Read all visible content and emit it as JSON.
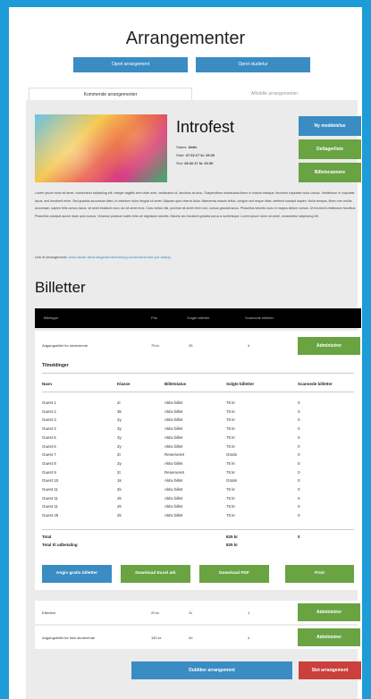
{
  "page": {
    "title": "Arrangementer"
  },
  "top_buttons": {
    "create_event": "Opret arrangement",
    "create_study_tour": "Opret studietur"
  },
  "tabs": {
    "upcoming": "Kommende arrangementer",
    "past": "Afholdte arrangementer"
  },
  "event": {
    "title": "Introfest",
    "status_label": "Status:",
    "status_value": "Aktiv",
    "start_label": "Start:",
    "start_value": "27.02.17 kl. 19.00",
    "end_label": "Slut:",
    "end_value": "28.02.17 kl. 02.00",
    "description": "Lorem ipsum dolor sit amet, consectetur adipiscing elit. Integer sagittis sem vitae ante, vestibulum id, faucibus ac arcu. Suspendisse malesuada libero in mauris tristique, tincidunt vulputate nulla cursus. Vestibulum in vulputate lacus, sed hendrerit enim. Sed gravida accumsan diam, in interdum dolor feugiat sit amet. Aliquam quis viverra dolor. Maecenas mauris tellus, congue sed neque vitae, eleifend suscipit sapien. Nulla tempus, libero nec mollis accumsan, sapien felis cursus lacus, sit amet tincidunt nunc dui sit amet eros. Cras metus nisi, pulvinar sit amet enim non, cursus gravida lacus. Phasellus lobortis nunc in magna dictum cursus. Ut tincidunt vestibulum faucibus. Phasellus volutpat auctor diam quis cursus. Vivamus pulvinar mattis felis vel dignissim lobortis. Mauris nec tincidunt gravida purus a scelerisque. Lorem ipsum dolor sit amet, consectetur adipiscing elit.",
    "link_label": "Link til arrangement:",
    "link_value": "www.studie.dk/arrangementer/bekrug-booker/test-fest-per-dialog"
  },
  "side_buttons": {
    "new_message": "Ny meddelelse",
    "participants": "Deltagerliste",
    "scan_tickets": "Billetscannere"
  },
  "tickets": {
    "heading": "Billetter",
    "columns": [
      "Billettype",
      "Pris",
      "Solgte billetter",
      "Scannede billetter"
    ],
    "main_ticket": {
      "name": "Adgangsbillet for studerende",
      "price": "75 kr.",
      "sold": "25",
      "scanned": "4",
      "admin": "Administrer"
    },
    "orders_label": "Tilmeldinger",
    "order_headers": [
      "Navn",
      "Klasse",
      "Billetstatus",
      "Solgte billetter",
      "Scannede billetter"
    ],
    "orders": [
      [
        "Guest 1",
        "2i",
        "Aktiv billet",
        "75 kr",
        "0"
      ],
      [
        "Guest 2",
        "3k",
        "Aktiv billet",
        "75 kr",
        "0"
      ],
      [
        "Guest 3",
        "2y",
        "Aktiv billet",
        "75 kr",
        "0"
      ],
      [
        "Guest 4",
        "3y",
        "Aktiv billet",
        "75 kr",
        "0"
      ],
      [
        "Guest 5",
        "3y",
        "Aktiv billet",
        "75 kr",
        "0"
      ],
      [
        "Guest 6",
        "2y",
        "Aktiv billet",
        "75 kr",
        "0"
      ],
      [
        "Guest 7",
        "2t",
        "Reserveret",
        "Gratis",
        "0"
      ],
      [
        "Guest 8",
        "2y",
        "Aktiv billet",
        "75 kr",
        "0"
      ],
      [
        "Guest 9",
        "2t",
        "Reserveret",
        "75 kr",
        "0"
      ],
      [
        "Guest 10",
        "1k",
        "Aktiv billet",
        "Gratis",
        "0"
      ],
      [
        "Guest 11",
        "2k",
        "Aktiv billet",
        "75 kr",
        "0"
      ],
      [
        "Guest 11",
        "2k",
        "Aktiv billet",
        "75 kr",
        "0"
      ],
      [
        "Guest 11",
        "2k",
        "Aktiv billet",
        "75 kr",
        "0"
      ],
      [
        "Guest 25",
        "2k",
        "Aktiv billet",
        "75 kr",
        "0"
      ]
    ],
    "total_label": "Total",
    "total_value": "825 kr",
    "total_scanned": "0",
    "payout_label": "Total til udbetaling",
    "payout_value": "825 kr",
    "actions": {
      "free_tickets": "Angiv gratis billetter",
      "excel": "Download Excel ark",
      "pdf": "Download PDF",
      "print": "Print"
    },
    "other_rows": [
      {
        "name": "Efterfest",
        "price": "20 kr.",
        "sold": "11",
        "scanned": "1",
        "admin": "Administrer"
      },
      {
        "name": "Adgangsbillet for ikke studerende",
        "price": "150 kr.",
        "sold": "40",
        "scanned": "4",
        "admin": "Administrer"
      }
    ]
  },
  "bottom_buttons": {
    "duplicate": "Dubliker arrangement",
    "delete": "Slet arrangement"
  },
  "colors": {
    "blue": "#3a8cc3",
    "green": "#6aa342",
    "red": "#c9403c",
    "background": "#1e9cd7"
  }
}
